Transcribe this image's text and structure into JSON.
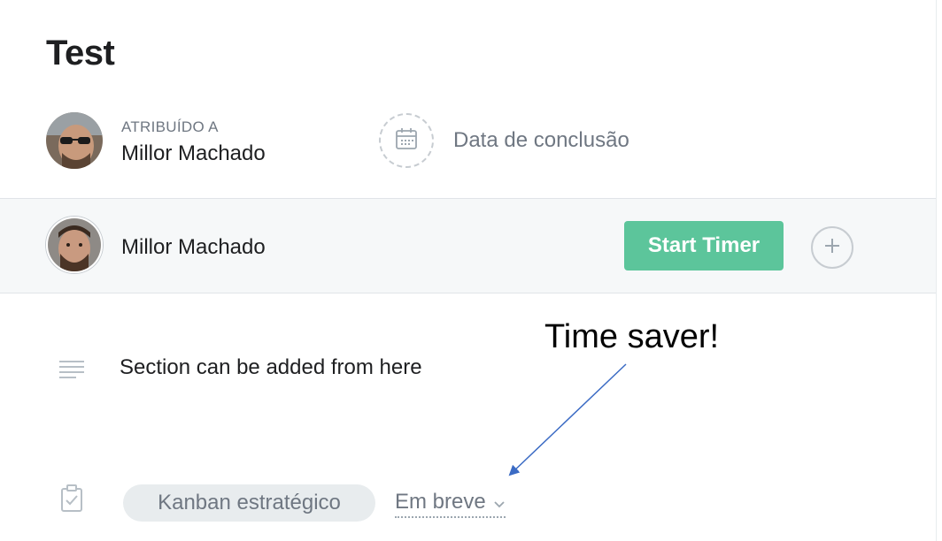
{
  "task": {
    "title": "Test"
  },
  "assignee": {
    "label": "ATRIBUÍDO A",
    "name": "Millor Machado"
  },
  "due_date": {
    "label": "Data de conclusão",
    "icon": "calendar-icon"
  },
  "followers": {
    "name": "Millor Machado",
    "start_timer_label": "Start Timer",
    "add_icon": "plus-icon"
  },
  "annotation": {
    "text": "Time saver!"
  },
  "description": {
    "icon": "text-lines-icon",
    "text": "Section can be added from here"
  },
  "projects": {
    "icon": "clipboard-check-icon",
    "project_name": "Kanban estratégico",
    "section_name": "Em breve"
  },
  "colors": {
    "start_timer_bg": "#5cc59b",
    "muted_text": "#6f7782",
    "pill_bg": "#e8ecee",
    "arrow": "#3b6bc4"
  }
}
